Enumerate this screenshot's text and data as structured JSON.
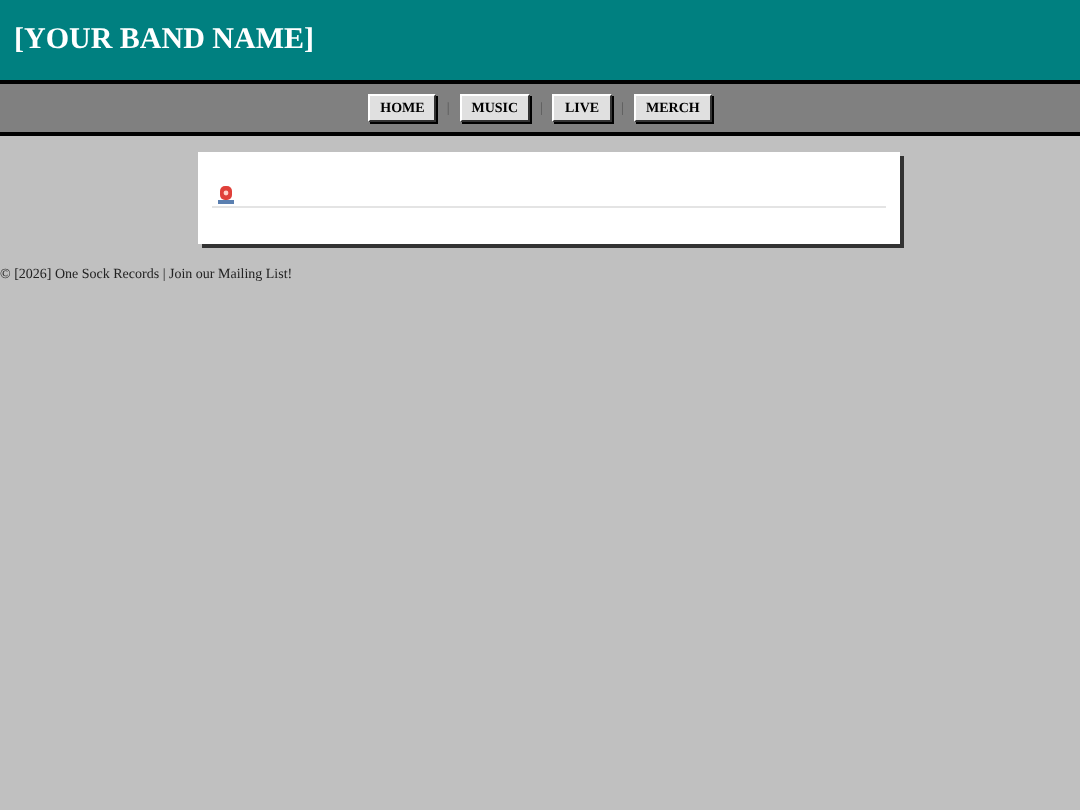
{
  "header": {
    "title": "[YOUR BAND NAME]"
  },
  "nav": {
    "separator": "|",
    "items": [
      {
        "label": "HOME"
      },
      {
        "label": "MUSIC"
      },
      {
        "label": "LIVE"
      },
      {
        "label": "MERCH"
      }
    ]
  },
  "footer": {
    "text": "© [2026] One Sock Records | Join our Mailing List!"
  }
}
